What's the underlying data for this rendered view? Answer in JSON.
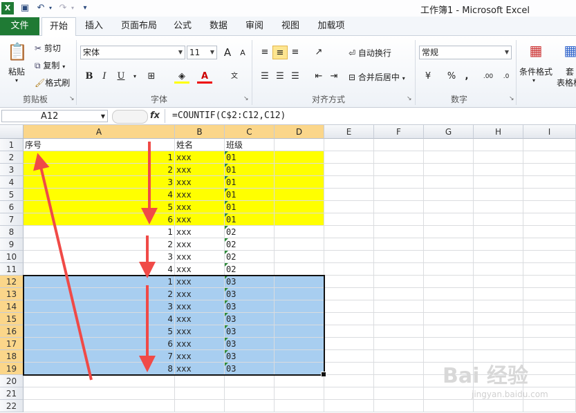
{
  "window": {
    "title": "工作簿1 - Microsoft Excel"
  },
  "quick_access": [
    {
      "name": "excel-logo-icon",
      "glyph": "X"
    },
    {
      "name": "save-icon",
      "glyph": "💾"
    },
    {
      "name": "undo-icon",
      "glyph": "↶"
    },
    {
      "name": "redo-icon",
      "glyph": "↷"
    },
    {
      "name": "customize-icon",
      "glyph": "▾"
    }
  ],
  "tabs": {
    "file": "文件",
    "items": [
      "开始",
      "插入",
      "页面布局",
      "公式",
      "数据",
      "审阅",
      "视图",
      "加载项"
    ],
    "active": 0
  },
  "ribbon": {
    "clipboard": {
      "label": "剪贴板",
      "paste": "粘贴",
      "cut": "剪切",
      "copy": "复制",
      "format_painter": "格式刷"
    },
    "font": {
      "label": "字体",
      "font_name": "宋体",
      "font_size": "11",
      "grow": "A",
      "shrink": "A",
      "bold": "B",
      "italic": "I",
      "underline": "U"
    },
    "alignment": {
      "label": "对齐方式",
      "wrap": "自动换行",
      "merge": "合并后居中"
    },
    "number": {
      "label": "数字",
      "format": "常规",
      "percent": "%",
      "comma": ",",
      "inc_decimal": ".00",
      "dec_decimal": ".0"
    },
    "styles": {
      "conditional": "条件格式",
      "table_partial": "套",
      "table2_partial": "表格格"
    }
  },
  "formula_bar": {
    "name_box": "A12",
    "fx": "fx",
    "formula": "=COUNTIF(C$2:C12,C12)"
  },
  "colors": {
    "yellow": "#ffff00",
    "blue": "#a8cef0",
    "selection": "#fbd68a",
    "arrow": "#f04a47"
  },
  "sheet": {
    "columns": [
      "A",
      "B",
      "C",
      "D",
      "E",
      "F",
      "G",
      "H",
      "I"
    ],
    "row_numbers": [
      "1",
      "2",
      "3",
      "4",
      "5",
      "6",
      "7",
      "8",
      "9",
      "10",
      "11",
      "12",
      "13",
      "14",
      "15",
      "16",
      "17",
      "18",
      "19",
      "20",
      "21",
      "22"
    ],
    "header": [
      "序号",
      "姓名",
      "班级"
    ],
    "rows": [
      [
        "1",
        "xxx",
        "01"
      ],
      [
        "2",
        "xxx",
        "01"
      ],
      [
        "3",
        "xxx",
        "01"
      ],
      [
        "4",
        "xxx",
        "01"
      ],
      [
        "5",
        "xxx",
        "01"
      ],
      [
        "6",
        "xxx",
        "01"
      ],
      [
        "1",
        "xxx",
        "02"
      ],
      [
        "2",
        "xxx",
        "02"
      ],
      [
        "3",
        "xxx",
        "02"
      ],
      [
        "4",
        "xxx",
        "02"
      ],
      [
        "1",
        "xxx",
        "03"
      ],
      [
        "2",
        "xxx",
        "03"
      ],
      [
        "3",
        "xxx",
        "03"
      ],
      [
        "4",
        "xxx",
        "03"
      ],
      [
        "5",
        "xxx",
        "03"
      ],
      [
        "6",
        "xxx",
        "03"
      ],
      [
        "7",
        "xxx",
        "03"
      ],
      [
        "8",
        "xxx",
        "03"
      ]
    ]
  },
  "watermark": {
    "brand": "Bai 经验",
    "url": "jingyan.baidu.com"
  }
}
